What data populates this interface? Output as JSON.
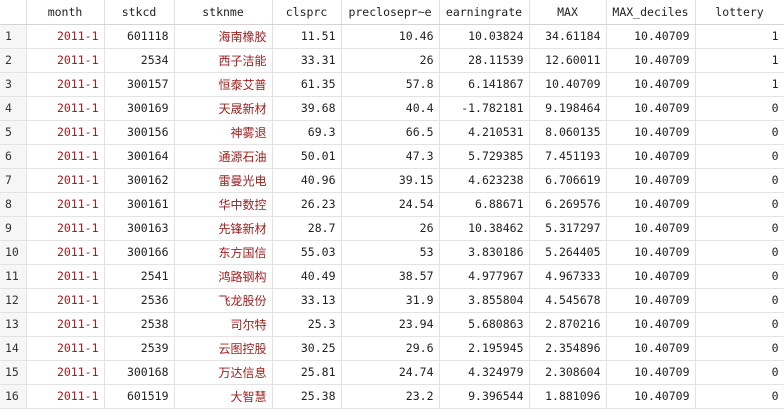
{
  "columns": [
    "month",
    "stkcd",
    "stknme",
    "clsprc",
    "preclosepr~e",
    "earningrate",
    "MAX",
    "MAX_deciles",
    "lottery"
  ],
  "rows": [
    {
      "n": "1",
      "month": "2011-1",
      "stkcd": "601118",
      "stknme": "海南橡胶",
      "clsprc": "11.51",
      "preclose": "10.46",
      "earningrate": "10.03824",
      "max": "34.61184",
      "deciles": "10.40709",
      "lottery": "1"
    },
    {
      "n": "2",
      "month": "2011-1",
      "stkcd": "2534",
      "stknme": "西子洁能",
      "clsprc": "33.31",
      "preclose": "26",
      "earningrate": "28.11539",
      "max": "12.60011",
      "deciles": "10.40709",
      "lottery": "1"
    },
    {
      "n": "3",
      "month": "2011-1",
      "stkcd": "300157",
      "stknme": "恒泰艾普",
      "clsprc": "61.35",
      "preclose": "57.8",
      "earningrate": "6.141867",
      "max": "10.40709",
      "deciles": "10.40709",
      "lottery": "1"
    },
    {
      "n": "4",
      "month": "2011-1",
      "stkcd": "300169",
      "stknme": "天晟新材",
      "clsprc": "39.68",
      "preclose": "40.4",
      "earningrate": "-1.782181",
      "max": "9.198464",
      "deciles": "10.40709",
      "lottery": "0"
    },
    {
      "n": "5",
      "month": "2011-1",
      "stkcd": "300156",
      "stknme": "神雾退",
      "clsprc": "69.3",
      "preclose": "66.5",
      "earningrate": "4.210531",
      "max": "8.060135",
      "deciles": "10.40709",
      "lottery": "0"
    },
    {
      "n": "6",
      "month": "2011-1",
      "stkcd": "300164",
      "stknme": "通源石油",
      "clsprc": "50.01",
      "preclose": "47.3",
      "earningrate": "5.729385",
      "max": "7.451193",
      "deciles": "10.40709",
      "lottery": "0"
    },
    {
      "n": "7",
      "month": "2011-1",
      "stkcd": "300162",
      "stknme": "雷曼光电",
      "clsprc": "40.96",
      "preclose": "39.15",
      "earningrate": "4.623238",
      "max": "6.706619",
      "deciles": "10.40709",
      "lottery": "0"
    },
    {
      "n": "8",
      "month": "2011-1",
      "stkcd": "300161",
      "stknme": "华中数控",
      "clsprc": "26.23",
      "preclose": "24.54",
      "earningrate": "6.88671",
      "max": "6.269576",
      "deciles": "10.40709",
      "lottery": "0"
    },
    {
      "n": "9",
      "month": "2011-1",
      "stkcd": "300163",
      "stknme": "先锋新材",
      "clsprc": "28.7",
      "preclose": "26",
      "earningrate": "10.38462",
      "max": "5.317297",
      "deciles": "10.40709",
      "lottery": "0"
    },
    {
      "n": "10",
      "month": "2011-1",
      "stkcd": "300166",
      "stknme": "东方国信",
      "clsprc": "55.03",
      "preclose": "53",
      "earningrate": "3.830186",
      "max": "5.264405",
      "deciles": "10.40709",
      "lottery": "0"
    },
    {
      "n": "11",
      "month": "2011-1",
      "stkcd": "2541",
      "stknme": "鸿路钢构",
      "clsprc": "40.49",
      "preclose": "38.57",
      "earningrate": "4.977967",
      "max": "4.967333",
      "deciles": "10.40709",
      "lottery": "0"
    },
    {
      "n": "12",
      "month": "2011-1",
      "stkcd": "2536",
      "stknme": "飞龙股份",
      "clsprc": "33.13",
      "preclose": "31.9",
      "earningrate": "3.855804",
      "max": "4.545678",
      "deciles": "10.40709",
      "lottery": "0"
    },
    {
      "n": "13",
      "month": "2011-1",
      "stkcd": "2538",
      "stknme": "司尔特",
      "clsprc": "25.3",
      "preclose": "23.94",
      "earningrate": "5.680863",
      "max": "2.870216",
      "deciles": "10.40709",
      "lottery": "0"
    },
    {
      "n": "14",
      "month": "2011-1",
      "stkcd": "2539",
      "stknme": "云图控股",
      "clsprc": "30.25",
      "preclose": "29.6",
      "earningrate": "2.195945",
      "max": "2.354896",
      "deciles": "10.40709",
      "lottery": "0"
    },
    {
      "n": "15",
      "month": "2011-1",
      "stkcd": "300168",
      "stknme": "万达信息",
      "clsprc": "25.81",
      "preclose": "24.74",
      "earningrate": "4.324979",
      "max": "2.308604",
      "deciles": "10.40709",
      "lottery": "0"
    },
    {
      "n": "16",
      "month": "2011-1",
      "stkcd": "601519",
      "stknme": "大智慧",
      "clsprc": "25.38",
      "preclose": "23.2",
      "earningrate": "9.396544",
      "max": "1.881096",
      "deciles": "10.40709",
      "lottery": "0"
    }
  ],
  "colors": {
    "string_text": "#a02020",
    "grid_line": "#e3e3e3",
    "rownum_bg": "#f6f6f6"
  }
}
